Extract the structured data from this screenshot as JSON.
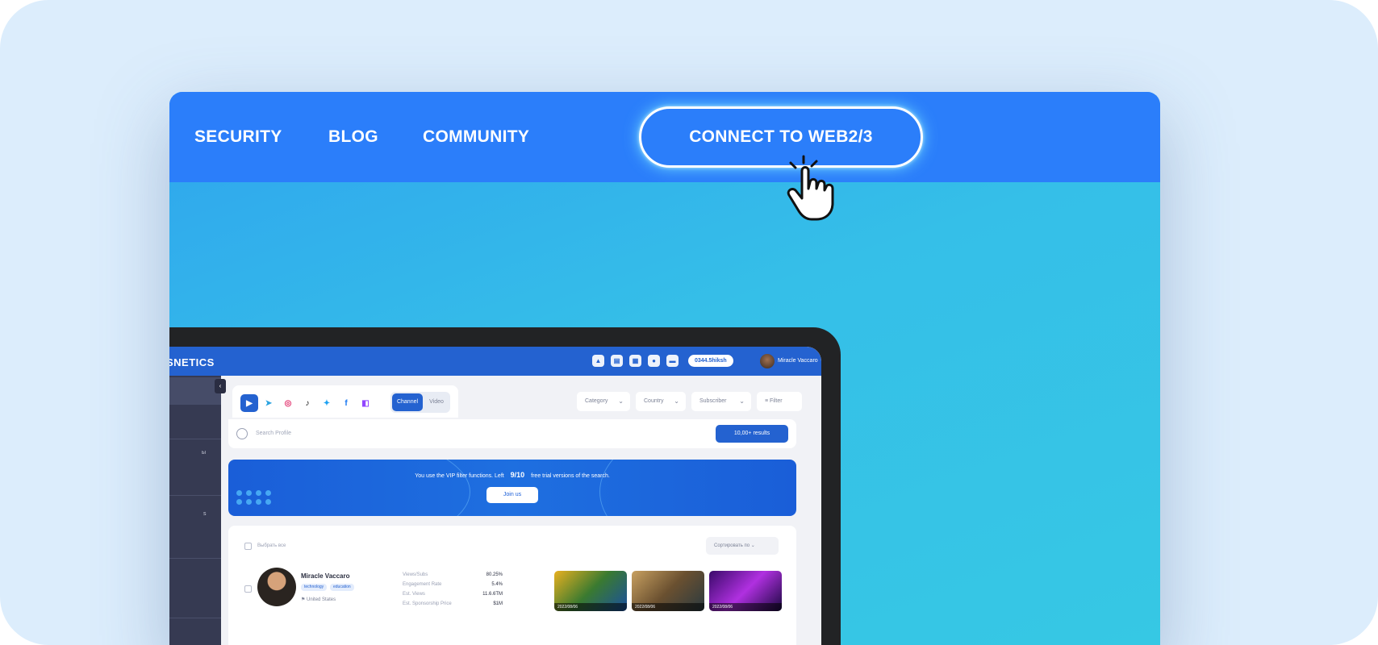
{
  "nav": {
    "links": [
      "SECURITY",
      "BLOG",
      "COMMUNITY"
    ],
    "cta_label": "CONNECT TO WEB2/3"
  },
  "colors": {
    "nav_bg": "#2b7efa",
    "hero_bg": "#36c8e4",
    "page_bg": "#dcedfc",
    "app_accent": "#2462d0"
  },
  "app": {
    "brand": "SNETICS",
    "balance": "0344.5hiksh",
    "user_name": "Miracle Vaccaro",
    "platforms": [
      "youtube-icon",
      "telegram-icon",
      "instagram-icon",
      "tiktok-icon",
      "twitter-icon",
      "facebook-icon",
      "twitch-icon"
    ],
    "tabs": [
      "Channel",
      "Video"
    ],
    "filters": [
      "Category",
      "Country",
      "Subscriber",
      "Filter"
    ],
    "search_placeholder": "Search Profile",
    "results_label": "10,00+ results",
    "vip": {
      "text_before": "You use the VIP filter functions. Left",
      "count": "9/10",
      "text_after": "free trial versions of the search.",
      "join_label": "Join us"
    },
    "list": {
      "select_all": "Выбрать все",
      "sort_label": "Сортировать по",
      "row": {
        "name": "Miracle Vaccaro",
        "tags": [
          "technology",
          "education"
        ],
        "country": "United States",
        "stats": [
          {
            "label": "Views/Subs",
            "value": "80.25%"
          },
          {
            "label": "Engagement Rate",
            "value": "5.4%"
          },
          {
            "label": "Est. Views",
            "value": "11.6.6TM"
          },
          {
            "label": "Est. Sponsorship Price",
            "value": "$1M"
          }
        ],
        "thumbs": [
          "2022/08/06",
          "2022/08/06",
          "2022/08/06"
        ]
      }
    }
  }
}
